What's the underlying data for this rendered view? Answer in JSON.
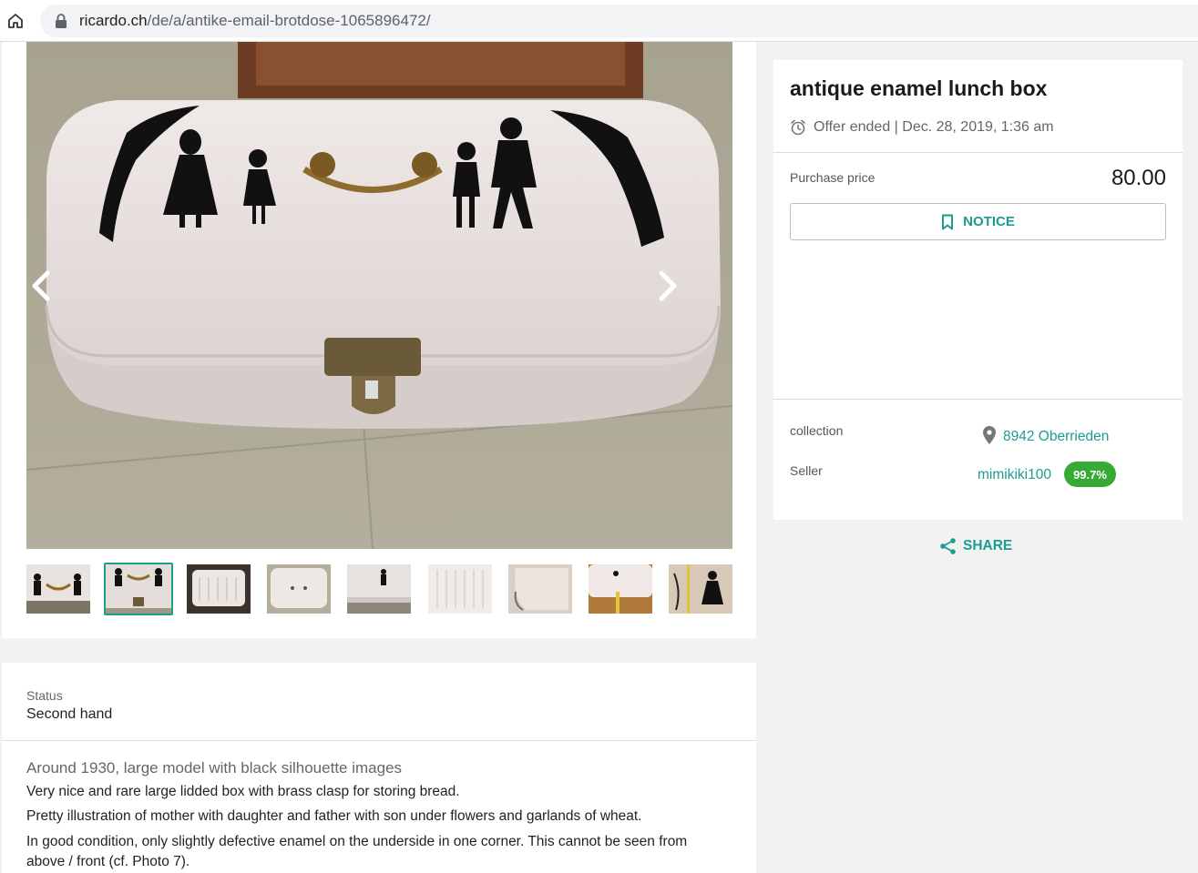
{
  "browser": {
    "url_host": "ricardo.ch",
    "url_path": "/de/a/antike-email-brotdose-1065896472/"
  },
  "listing": {
    "title": "antique enamel lunch box",
    "ended_text": "Offer ended | Dec. 28, 2019, 1:36 am",
    "price_label": "Purchase price",
    "price": "80.00",
    "notice_label": "NOTICE",
    "collection_label": "collection",
    "location": "8942 Oberrieden",
    "seller_label": "Seller",
    "seller": "mimikiki100",
    "rating": "99.7%",
    "share_label": "SHARE"
  },
  "details": {
    "status_label": "Status",
    "status_value": "Second hand",
    "description_title": "Around 1930, large model with black silhouette images",
    "description_lines": [
      "Very nice and rare large lidded box with brass clasp for storing bread.",
      "Pretty illustration of mother with daughter and father with son under flowers and garlands of wheat.",
      "In good condition, only slightly defective enamel on the underside in one corner. This cannot be seen from above / front (cf. Photo 7)."
    ]
  },
  "gallery": {
    "photo_count": 9,
    "active_index": 1
  },
  "colors": {
    "accent": "#1e9c8e",
    "rating_badge": "#39a935"
  },
  "icons": {
    "home": "home-icon",
    "lock": "lock-icon",
    "prev": "chevron-left-icon",
    "next": "chevron-right-icon",
    "clock": "alarm-clock-icon",
    "bookmark": "bookmark-icon",
    "pin": "map-pin-icon",
    "share": "share-icon"
  }
}
